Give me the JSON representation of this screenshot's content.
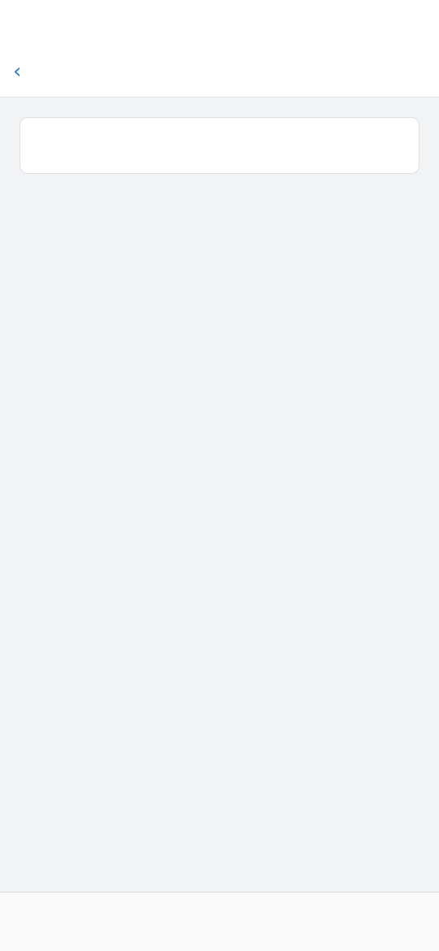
{
  "status_bar": {
    "time": "",
    "battery": ""
  },
  "nav": {
    "title": ""
  },
  "card": {
    "heading": "",
    "body": ""
  }
}
